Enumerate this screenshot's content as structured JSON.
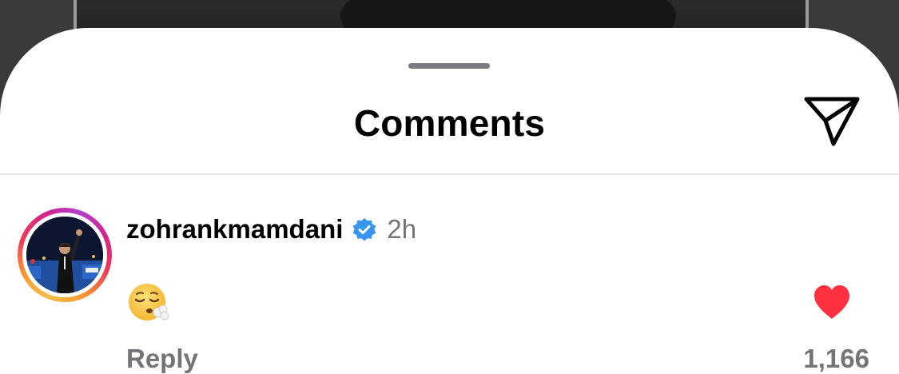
{
  "sheet": {
    "title": "Comments"
  },
  "comment": {
    "username": "zohrankmamdani",
    "verified": true,
    "time": "2h",
    "text_emoji": "😮‍💨",
    "reply_label": "Reply",
    "like_count": "1,166",
    "liked": true
  },
  "colors": {
    "heart": "#ff3040",
    "verified_badge": "#3797f0",
    "secondary_text": "#737378"
  },
  "icons": {
    "send": "paper-plane-icon",
    "like": "heart-filled-icon",
    "verified": "verified-badge-icon",
    "emoji": "face-exhaling-emoji"
  }
}
